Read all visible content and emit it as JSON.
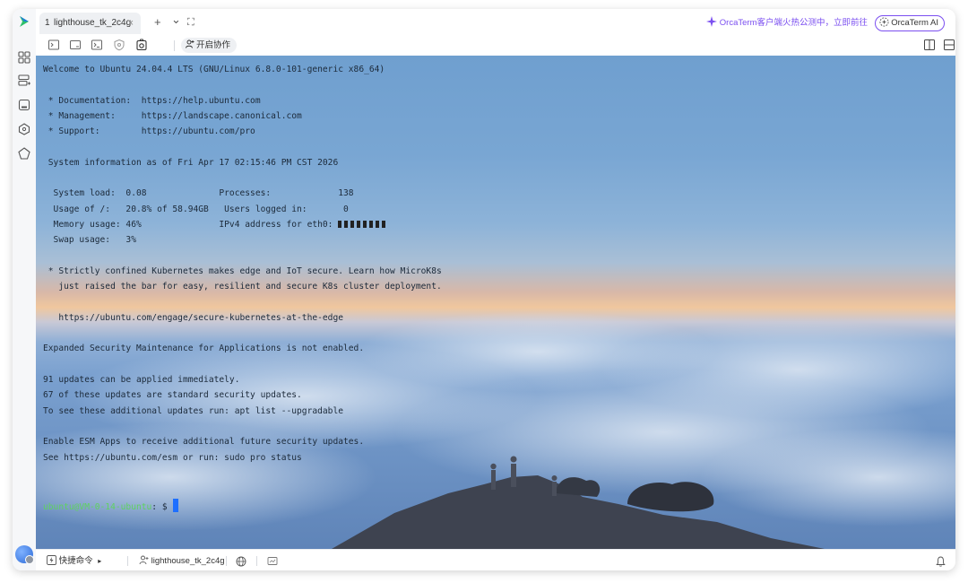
{
  "tabbar": {
    "tab": {
      "index": "1",
      "title": "lighthouse_tk_2c4g",
      "close": "×"
    },
    "add_label": "+",
    "dropdown_label": "⌄",
    "expand_label": "⛶",
    "promo_text": "OrcaTerm客户端火热公测中，立即前往",
    "ai_label": "OrcaTerm AI"
  },
  "toolbar": {
    "collab_label": "开启协作"
  },
  "terminal": {
    "lines": [
      "Welcome to Ubuntu 24.04.4 LTS (GNU/Linux 6.8.0-101-generic x86_64)",
      "",
      " * Documentation:  https://help.ubuntu.com",
      " * Management:     https://landscape.canonical.com",
      " * Support:        https://ubuntu.com/pro",
      "",
      " System information as of Fri Apr 17 02:15:46 PM CST 2026",
      "",
      "  System load:  0.08              Processes:             138",
      "  Usage of /:   20.8% of 58.94GB   Users logged in:       0",
      "  Memory usage: 46%               IPv4 address for eth0: ",
      "  Swap usage:   3%",
      "",
      " * Strictly confined Kubernetes makes edge and IoT secure. Learn how MicroK8s",
      "   just raised the bar for easy, resilient and secure K8s cluster deployment.",
      "",
      "   https://ubuntu.com/engage/secure-kubernetes-at-the-edge",
      "",
      "Expanded Security Maintenance for Applications is not enabled.",
      "",
      "91 updates can be applied immediately.",
      "67 of these updates are standard security updates.",
      "To see these additional updates run: apt list --upgradable",
      "",
      "Enable ESM Apps to receive additional future security updates.",
      "See https://ubuntu.com/esm or run: sudo pro status"
    ],
    "prompt_user": "ubuntu@VM-0-14-ubuntu",
    "prompt_rest": ": $ "
  },
  "statusbar": {
    "quick_cmd_label": "快捷命令",
    "quick_cmd_arrow": "▸",
    "session_label": "lighthouse_tk_2c4g"
  },
  "colors": {
    "accent": "#7b4ff0",
    "prompt_green": "#5fd35f",
    "cursor_blue": "#1e6fff"
  }
}
